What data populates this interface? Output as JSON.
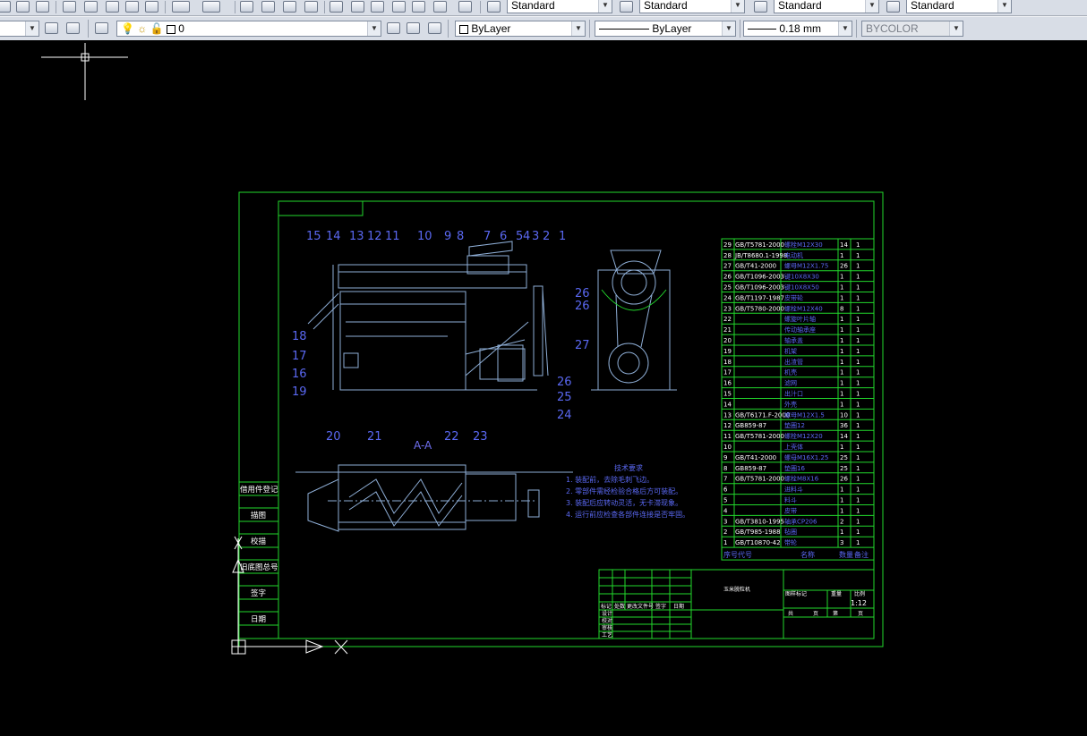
{
  "toolbar_top": {
    "text_style": "Standard",
    "dim_style": "Standard",
    "table_style": "Standard",
    "mleader_style": "Standard"
  },
  "toolbar_layers": {
    "current_layer": "0",
    "color": "ByLayer",
    "linetype": "ByLayer",
    "lineweight": "0.18 mm",
    "plot_style": "BYCOLOR"
  },
  "icons": [
    "open-icon",
    "save-icon",
    "publish-icon",
    "cut-icon",
    "copy-icon",
    "paste-icon",
    "match-properties-icon",
    "block-editor-icon",
    "undo-icon",
    "redo-icon",
    "pan-icon",
    "zoom-realtime-icon",
    "zoom-window-icon",
    "zoom-previous-icon",
    "properties-icon",
    "design-center-icon",
    "tool-palettes-icon",
    "sheet-set-icon",
    "markup-icon",
    "quickcalc-icon",
    "help-icon",
    "text-style-icon",
    "dim-style-icon",
    "table-style-icon",
    "mleader-style-icon",
    "workspace-settings-icon",
    "layer-properties-icon",
    "layer-on-icon",
    "layer-freeze-icon",
    "layer-lock-icon",
    "make-current-icon",
    "layer-previous-icon",
    "color-swatch-icon"
  ],
  "drawing": {
    "section_label": "A-A",
    "part_number_labels_top": [
      "15",
      "14",
      "13",
      "12",
      "11",
      "10",
      "9",
      "8",
      "7",
      "6",
      "5",
      "4",
      "3",
      "2",
      "1"
    ],
    "part_number_labels_side": [
      "18",
      "17",
      "16",
      "19"
    ],
    "part_number_labels_right": [
      "26",
      "25",
      "27",
      "24"
    ],
    "part_number_labels_bottom": [
      "20",
      "21",
      "22",
      "23"
    ],
    "tech_req_title": "技术要求",
    "tech_req": [
      "1. 装配前，去除毛刺飞边。",
      "2. 零部件需经检验合格后方可装配。",
      "3. 装配后应转动灵活，无卡滞现象。",
      "4. 运行前应检查各部件连接是否牢固。"
    ],
    "bom_rows": [
      [
        "29",
        "GB/T5781-2000",
        "螺栓M12X30",
        "14",
        "1"
      ],
      [
        "28",
        "JB/T8680.1-1998",
        "电动机",
        "1",
        "1"
      ],
      [
        "27",
        "GB/T41-2000",
        "螺母M12X1.75",
        "26",
        "1"
      ],
      [
        "26",
        "GB/T1096-2003",
        "键10X8X30",
        "1",
        "1"
      ],
      [
        "25",
        "GB/T1096-2003",
        "键10X8X50",
        "1",
        "1"
      ],
      [
        "24",
        "GB/T1197-1987",
        "皮带轮",
        "1",
        "1"
      ],
      [
        "23",
        "GB/T5780-2000",
        "螺栓M12X40",
        "8",
        "1"
      ],
      [
        "22",
        "",
        "螺旋叶片轴",
        "1",
        "1"
      ],
      [
        "21",
        "",
        "传动轴承座",
        "1",
        "1"
      ],
      [
        "20",
        "",
        "轴承盖",
        "1",
        "1"
      ],
      [
        "19",
        "",
        "机架",
        "1",
        "1"
      ],
      [
        "18",
        "",
        "出渣管",
        "1",
        "1"
      ],
      [
        "17",
        "",
        "机壳",
        "1",
        "1"
      ],
      [
        "16",
        "",
        "滤网",
        "1",
        "1"
      ],
      [
        "15",
        "",
        "出汁口",
        "1",
        "1"
      ],
      [
        "14",
        "",
        "外壳",
        "1",
        "1"
      ],
      [
        "13",
        "GB/T6171.F-2000",
        "螺母M12X1.5",
        "10",
        "1"
      ],
      [
        "12",
        "GB859-87",
        "垫圈12",
        "36",
        "1"
      ],
      [
        "11",
        "GB/T5781-2000",
        "螺栓M12X20",
        "14",
        "1"
      ],
      [
        "10",
        "",
        "上壳体",
        "1",
        "1"
      ],
      [
        "9",
        "GB/T41-2000",
        "螺母M16X1.25",
        "25",
        "1"
      ],
      [
        "8",
        "GB859-87",
        "垫圈16",
        "25",
        "1"
      ],
      [
        "7",
        "GB/T5781-2000",
        "螺栓M8X16",
        "26",
        "1"
      ],
      [
        "6",
        "",
        "进料斗",
        "1",
        "1"
      ],
      [
        "5",
        "",
        "料斗",
        "1",
        "1"
      ],
      [
        "4",
        "",
        "皮带",
        "1",
        "1"
      ],
      [
        "3",
        "GB/T3810-1995",
        "轴承CP206",
        "2",
        "1"
      ],
      [
        "2",
        "GB/T985-1988",
        "毡圈",
        "1",
        "1"
      ],
      [
        "1",
        "GB/T10870-42",
        "带轮",
        "3",
        "1"
      ]
    ],
    "bom_header": [
      "序号代号",
      "名称",
      "数量",
      "备注"
    ],
    "title_block_name": "玉米脱粒机",
    "title_block_scale": "1:12",
    "title_block_labels": [
      "图样标记",
      "重量",
      "比例",
      "共",
      "页",
      "第",
      "页",
      "标记",
      "处数",
      "更改文件号",
      "签字",
      "日期",
      "设计",
      "校对",
      "审核",
      "工艺",
      "标准化",
      "批准"
    ],
    "sidebar_labels": [
      "借用件登记",
      "描图",
      "校描",
      "旧底图总号",
      "签字",
      "日期"
    ]
  }
}
